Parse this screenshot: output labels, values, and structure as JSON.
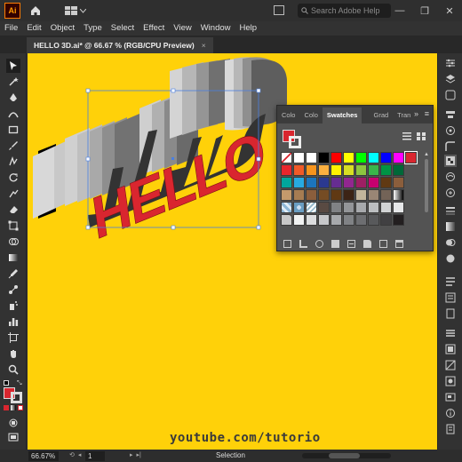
{
  "app": {
    "logo": "Ai",
    "search_placeholder": "Search Adobe Help",
    "window_buttons": [
      "—",
      "❐",
      "✕"
    ]
  },
  "menubar": [
    "File",
    "Edit",
    "Object",
    "Type",
    "Select",
    "Effect",
    "View",
    "Window",
    "Help"
  ],
  "document_tab": {
    "title": "HELLO 3D.ai* @ 66.67 % (RGB/CPU Preview)",
    "close": "×"
  },
  "artwork": {
    "text": "HELLO",
    "face_color": "#d9262f"
  },
  "swatches_panel": {
    "tabs": [
      "Colo",
      "Colo",
      "Swatches",
      "Grad",
      "Tran"
    ],
    "active_tab": "Swatches",
    "more": "»",
    "menu": "≡",
    "rows": [
      [
        "none",
        "#ffffff",
        "#ffffff",
        "#000000",
        "#ff0000",
        "#ffff00",
        "#00ff00",
        "#00ffff",
        "#0000ff",
        "#ff00ff",
        "#d9262f"
      ],
      [
        "#e8262c",
        "#f05a28",
        "#f7941d",
        "#fbb040",
        "#fff200",
        "#d7df23",
        "#8dc63f",
        "#39b54a",
        "#009444",
        "#006838"
      ],
      [
        "#00a79d",
        "#27aae1",
        "#1c75bc",
        "#2b3990",
        "#662d91",
        "#92278f",
        "#9e1f63",
        "#c7006f",
        "#603913",
        "#8b5e3c"
      ],
      [
        "#c49a6c",
        "#a67c52",
        "#8b5e3c",
        "#754c24",
        "#603913",
        "#3c2415",
        "#c2b59b",
        "#998675",
        "#736357",
        "#ffffff-grad"
      ],
      [
        "pattern",
        "pattern2",
        "pattern3",
        "#594a42",
        "#808285",
        "#939598",
        "#a7a9ac",
        "#bcbec0",
        "#d1d3d4",
        "#e6e7e8"
      ],
      [
        "folder",
        "#f1f2f2",
        "#dcddde",
        "#c7c8ca",
        "#a7a9ac",
        "#808285",
        "#6d6e71",
        "#58595b",
        "#414042",
        "#231f20"
      ]
    ]
  },
  "statusbar": {
    "zoom": "66.67%",
    "page": "1",
    "tool": "Selection"
  },
  "watermark": "youtube.com/tutorio"
}
